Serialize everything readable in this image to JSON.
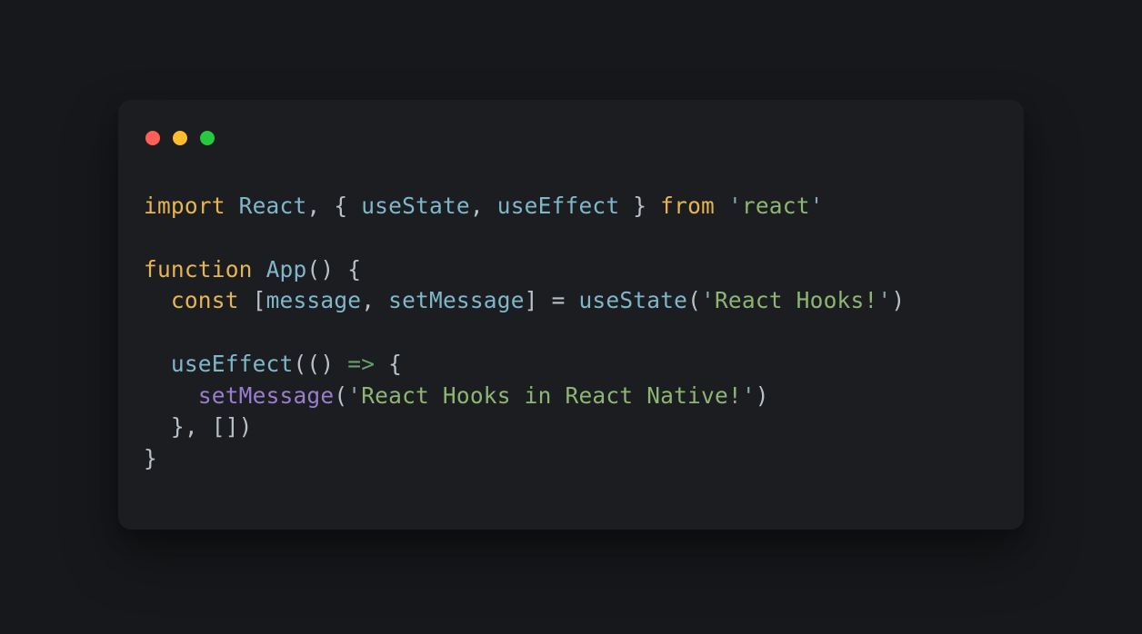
{
  "code": {
    "line1": {
      "kw_import": "import",
      "react": "React",
      "comma1": ",",
      "brace_open": "{",
      "use_state": "useState",
      "comma2": ",",
      "use_effect": "useEffect",
      "brace_close": "}",
      "kw_from": "from",
      "q1": "'",
      "str": "react",
      "q2": "'"
    },
    "line3": {
      "kw_function": "function",
      "app": "App",
      "parens": "()",
      "brace": "{"
    },
    "line4": {
      "indent": "  ",
      "kw_const": "const",
      "br_open": "[",
      "msg": "message",
      "comma": ",",
      "setmsg": "setMessage",
      "br_close": "]",
      "eq": "=",
      "use_state": "useState",
      "paren_open": "(",
      "q1": "'",
      "str": "React Hooks!",
      "q2": "'",
      "paren_close": ")"
    },
    "line6": {
      "indent": "  ",
      "use_effect": "useEffect",
      "open": "((",
      "close_paren": ")",
      "arrow": "=>",
      "brace": "{"
    },
    "line7": {
      "indent": "    ",
      "setmsg": "setMessage",
      "paren_open": "(",
      "q1": "'",
      "str": "React Hooks in React Native!",
      "q2": "'",
      "paren_close": ")"
    },
    "line8": {
      "indent": "  ",
      "close": "}, [])"
    },
    "line9": {
      "close": "}"
    }
  }
}
